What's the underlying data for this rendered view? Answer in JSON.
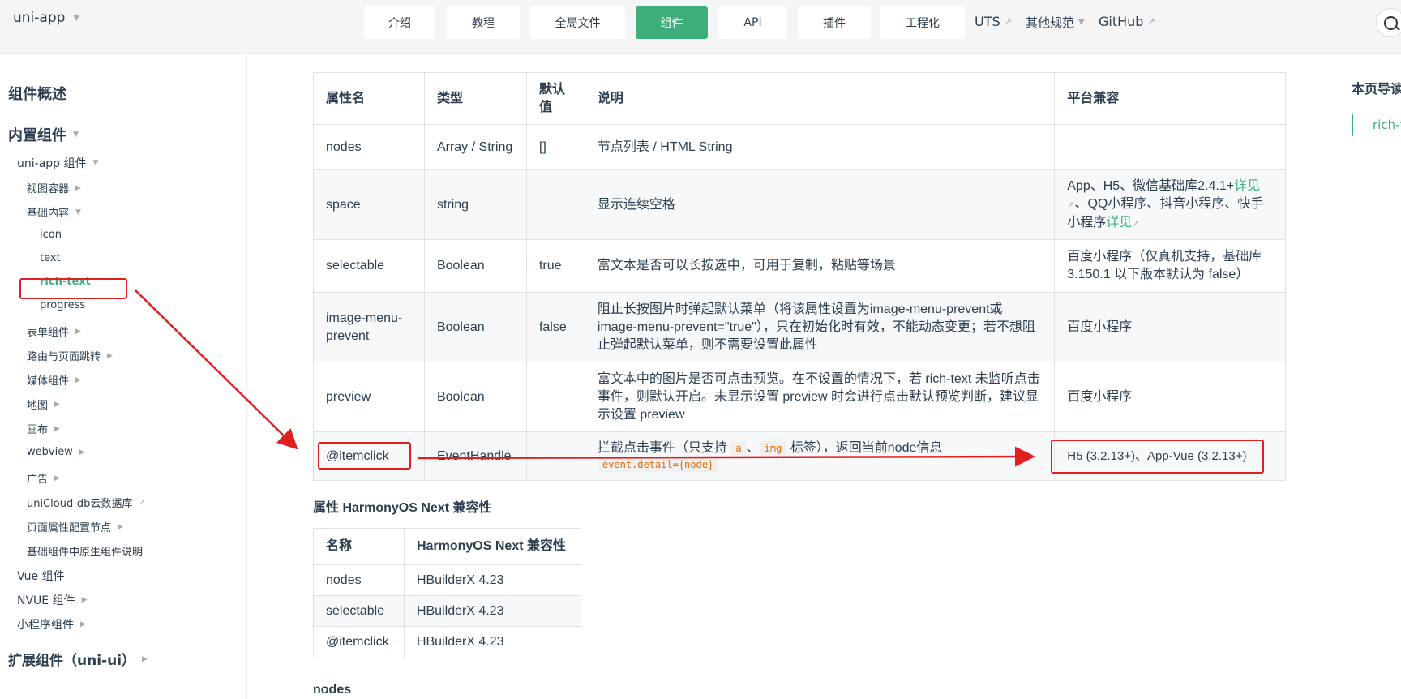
{
  "navbar": {
    "brand": "uni-app",
    "buttons": [
      "介绍",
      "教程",
      "全局文件",
      "组件",
      "API",
      "插件",
      "工程化"
    ],
    "links": [
      "UTS",
      "其他规范",
      "GitHub"
    ],
    "active": "组件"
  },
  "sidebar": {
    "overview": "组件概述",
    "builtin": "内置组件",
    "uniapp_components": "uni-app 组件",
    "view_container": "视图容器",
    "basic_content": "基础内容",
    "icon": "icon",
    "text": "text",
    "rich_text": "rich-text",
    "progress": "progress",
    "form": "表单组件",
    "route": "路由与页面跳转",
    "media": "媒体组件",
    "map": "地图",
    "canvas": "画布",
    "webview": "webview",
    "ad": "广告",
    "unicloud_db": "uniCloud-db云数据库",
    "page_meta": "页面属性配置节点",
    "native_desc": "基础组件中原生组件说明",
    "vue": "Vue 组件",
    "nvue": "NVUE 组件",
    "mini": "小程序组件",
    "extension": "扩展组件（uni-ui）"
  },
  "attr_table": {
    "headers": [
      "属性名",
      "类型",
      "默认\n值",
      "说明",
      "平台兼容"
    ],
    "rows": [
      {
        "name": "nodes",
        "type": "Array / String",
        "default": "[]",
        "desc": "节点列表 / HTML String",
        "platform": ""
      },
      {
        "name": "space",
        "type": "string",
        "default": "",
        "desc": "显示连续空格",
        "platform_parts": [
          "App、H5、微信基础库2.4.1+",
          "详见",
          "、QQ小程序、抖音小程序、快手小程序",
          "详见"
        ]
      },
      {
        "name": "selectable",
        "type": "Boolean",
        "default": "true",
        "desc": "富文本是否可以长按选中，可用于复制，粘贴等场景",
        "platform": "百度小程序（仅真机支持，基础库 3.150.1 以下版本默认为 false）"
      },
      {
        "name": "image-menu-prevent",
        "type": "Boolean",
        "default": "false",
        "desc": "阻止长按图片时弹起默认菜单（将该属性设置为image-menu-prevent或image-menu-prevent=\"true\"），只在初始化时有效，不能动态变更；若不想阻止弹起默认菜单，则不需要设置此属性",
        "platform": "百度小程序"
      },
      {
        "name": "preview",
        "type": "Boolean",
        "default": "",
        "desc": "富文本中的图片是否可点击预览。在不设置的情况下，若 rich-text 未监听点击事件，则默认开启。未显示设置 preview 时会进行点击默认预览判断，建议显示设置 preview",
        "platform": "百度小程序"
      },
      {
        "name": "@itemclick",
        "type": "EventHandle",
        "default": "",
        "desc_parts": [
          "拦截点击事件（只支持",
          "a",
          "、",
          "img",
          "标签），返回当前node信息",
          "event.detail={node}"
        ],
        "platform": "H5 (3.2.13+)、App-Vue (3.2.13+)"
      }
    ]
  },
  "harmony": {
    "title": "属性 HarmonyOS Next 兼容性",
    "headers": [
      "名称",
      "HarmonyOS Next 兼容性"
    ],
    "rows": [
      [
        "nodes",
        "HBuilderX 4.23"
      ],
      [
        "selectable",
        "HBuilderX 4.23"
      ],
      [
        "@itemclick",
        "HBuilderX 4.23"
      ]
    ]
  },
  "nodes_heading": "nodes",
  "toc": {
    "title": "本页导读",
    "item": "rich-text"
  },
  "colors": {
    "accent": "#3eaf7c",
    "annotation": "#e02020"
  }
}
